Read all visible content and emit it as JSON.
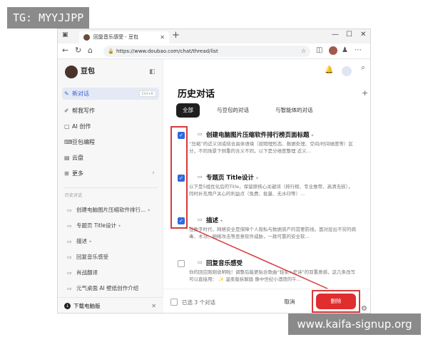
{
  "overlay": {
    "top_left_tag": "TG: MYYJJPP",
    "bottom_right_tag": "www.kaifa-signup.org"
  },
  "browser": {
    "tab_title": "回复音乐感受 - 豆包",
    "url": "https://www.doubao.com/chat/thread/list"
  },
  "sidebar": {
    "brand": "豆包",
    "items": [
      {
        "label": "新对话",
        "shortcut": "Ctrl+K"
      },
      {
        "label": "帮我写作"
      },
      {
        "label": "AI 创作"
      },
      {
        "label": "豆包编程"
      },
      {
        "label": "云盘"
      },
      {
        "label": "更多"
      }
    ],
    "history_label": "历史对话",
    "history": [
      "创建电脑图片压缩软件排行...",
      "专题页 Title设计",
      "描述",
      "回复音乐感受",
      "肖战翻译",
      "元气桌面 AI 壁纸创作介绍"
    ],
    "download": "下载电脑版"
  },
  "main": {
    "title": "历史对话",
    "filters": [
      "全部",
      "与豆包的对话",
      "与智能体的对话"
    ],
    "rows": [
      {
        "title": "创建电脑图片压缩软件排行榜页面标题",
        "checked": true,
        "desc": "“压缩”的近义词或结合具体语境（如物理形态、数据处理、空间/时间维度等）区分，不同场景下侧重的含义不同，以下是分维度整理 近义..."
      },
      {
        "title": "专题页 Title设计",
        "checked": true,
        "desc": "以下是5组优化后的Title，保留原核心关键词（排行榜、专业推荐、高清无损），同时补充用户关心的利益点（免费、批量、无水印等）..."
      },
      {
        "title": "描述",
        "checked": true,
        "desc": "在数字时代，网络安全是保障个人隐私与数据资产的首要防线。面对层出不穷的病毒、木马、网络攻击等恶意软件威胁，一款可靠的安全软..."
      },
      {
        "title": "回复音乐感受",
        "checked": false,
        "desc": "你的回应刚刚说明啦！调整后能更贴合歌曲“轻柔+史诗”的双重质感，这几条改写可以直接用： ✨ 温柔版拆解版 像中世纪小酒馆的午..."
      }
    ],
    "selected_text": "已选 3 个对话",
    "cancel": "取消",
    "delete": "删除"
  },
  "colors": {
    "accent": "#2f6bdd",
    "danger": "#e02d2d",
    "highlight": "#d63a3a"
  }
}
